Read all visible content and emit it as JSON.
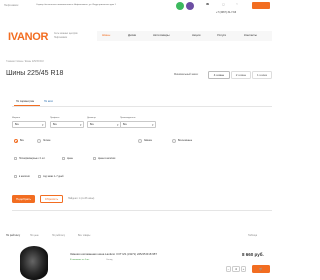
{
  "header": {
    "location": "Нефтекамск",
    "notice": "Сервер бесплатного шиномонтажа в Нефтекамске, ул. Индустриальная дом 1",
    "phone": "+7 (3467) 31-7-63",
    "logo": "IVANOR",
    "address_line1": "Сеть шинных центров",
    "address_line2": "Нефтекамск",
    "colors": {
      "accent": "#f26d21",
      "nav_bg": "#f7f7f7",
      "whatsapp": "#3cb95e",
      "viber": "#6c4ea3"
    }
  },
  "nav": {
    "items": [
      "Шины",
      "Диски",
      "Автотовары",
      "Акции",
      "Услуги",
      "Контакты"
    ]
  },
  "breadcrumb": "Главная / Шины / Шины 225/45 R18",
  "page_title": "Шины 225/45 R18",
  "season_filter": {
    "label": "Минимальный заказ:",
    "options": [
      "4 шины",
      "2 шины",
      "1 шина"
    ],
    "active_index": 0
  },
  "tabs": {
    "by_params": "По параметрам",
    "by_auto": "По авто"
  },
  "filters": {
    "labels": [
      "Ширина",
      "Профиль",
      "Диаметр",
      "Производитель"
    ],
    "values": [
      "Все",
      "Все",
      "Все",
      "Все"
    ]
  },
  "seasons": {
    "options": [
      "Все",
      "Летние",
      "Зимние",
      "Всесезонные"
    ],
    "selected_index": 0
  },
  "checkboxes": {
    "row1": [
      "Полноразмерные с 1 шт.",
      "Цены",
      "Цены в наличии"
    ],
    "row2": [
      "в наличии",
      "под заказ 1–7 дней"
    ]
  },
  "actions": {
    "submit": "Подобрать",
    "reset": "Сбросить",
    "found": "Найдено: 1 (из 28 шины)"
  },
  "sort": {
    "label": "По рейтингу",
    "options": [
      "По цене",
      "По рейтингу",
      "Все товары"
    ],
    "view": "Таблица"
  },
  "product": {
    "title": "Зимняя шипованная шина Laufenn I FIT IZ1 (LW71) 225/45 R18 95T",
    "status": "В наличии: от 4 шт.",
    "stock_label": "Склад:",
    "price": "8 660 руб.",
    "qty": "4",
    "cart_icon": "cart-icon"
  }
}
